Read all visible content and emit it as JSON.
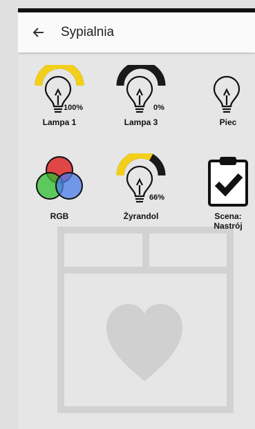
{
  "header": {
    "title": "Sypialnia",
    "back_icon": "arrow-left-icon"
  },
  "devices": [
    {
      "label": "Lampa 1",
      "icon": "bulb-icon",
      "level_percent": 100,
      "level_text": "100%",
      "arc_color": "#f2cf1a"
    },
    {
      "label": "Lampa 3",
      "icon": "bulb-icon",
      "level_percent": 0,
      "level_text": "0%",
      "arc_color": "#f2cf1a"
    },
    {
      "label": "Piec",
      "icon": "bulb-icon"
    },
    {
      "label": "RGB",
      "icon": "rgb-circles-icon"
    },
    {
      "label": "Żyrandol",
      "icon": "bulb-icon",
      "level_percent": 66,
      "level_text": "66%",
      "arc_color": "#f2cf1a"
    },
    {
      "label": "Scena:\nNastrój",
      "icon": "clipboard-check-icon"
    }
  ],
  "colors": {
    "arc_on": "#f2cf1a",
    "arc_off": "#1a1a1a",
    "background": "#e6e6e6"
  }
}
